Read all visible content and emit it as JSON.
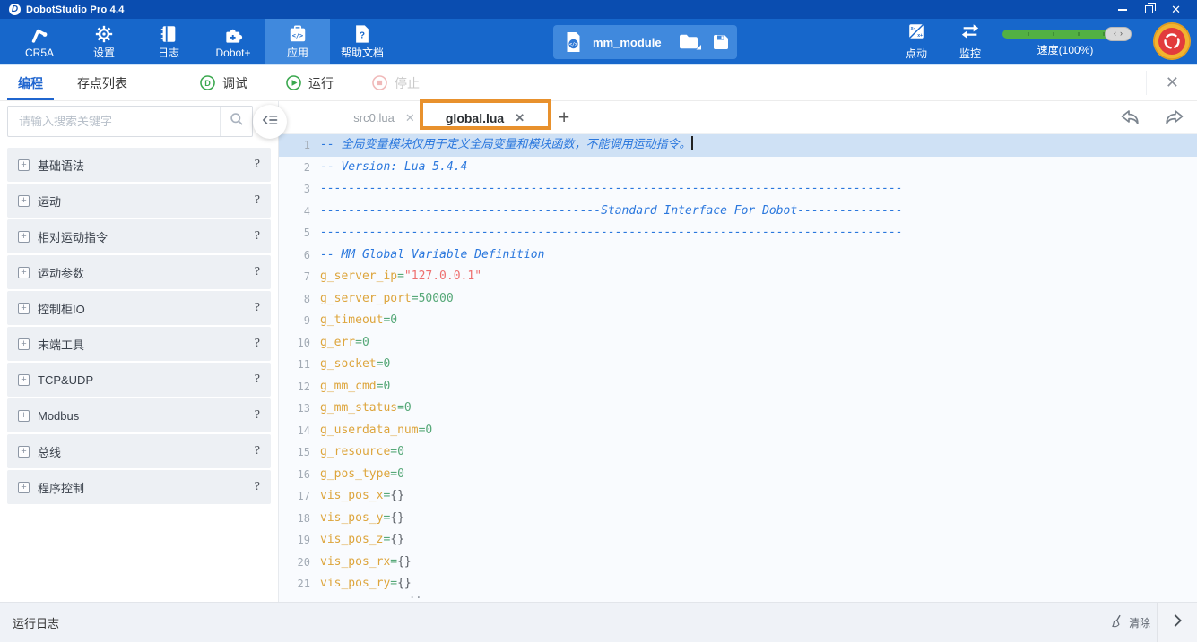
{
  "window": {
    "title": "DobotStudio Pro 4.4"
  },
  "toolbar": {
    "items": [
      {
        "key": "cr5a",
        "label": "CR5A",
        "icon": "robot-arm-icon",
        "active": false
      },
      {
        "key": "settings",
        "label": "设置",
        "icon": "gear-icon",
        "active": false
      },
      {
        "key": "logs",
        "label": "日志",
        "icon": "logbook-icon",
        "active": false
      },
      {
        "key": "dobot-plus",
        "label": "Dobot+",
        "icon": "puzzle-icon",
        "active": false
      },
      {
        "key": "apps",
        "label": "应用",
        "icon": "app-code-icon",
        "active": true
      },
      {
        "key": "help-docs",
        "label": "帮助文档",
        "icon": "help-doc-icon",
        "active": false
      }
    ],
    "project": {
      "name": "mm_module"
    },
    "right": {
      "jog_label": "点动",
      "monitor_label": "监控",
      "speed_label": "速度(100%)",
      "speed_percent": 100
    }
  },
  "nav": {
    "tabs": [
      {
        "key": "programming",
        "label": "编程",
        "active": true
      },
      {
        "key": "point-list",
        "label": "存点列表",
        "active": false
      }
    ],
    "actions": [
      {
        "key": "debug",
        "label": "调试",
        "disabled": false
      },
      {
        "key": "run",
        "label": "运行",
        "disabled": false
      },
      {
        "key": "stop",
        "label": "停止",
        "disabled": true
      }
    ]
  },
  "sidebar": {
    "search_placeholder": "请输入搜索关键字",
    "items": [
      {
        "label": "基础语法",
        "help": "?"
      },
      {
        "label": "运动",
        "help": "?"
      },
      {
        "label": "相对运动指令",
        "help": "?"
      },
      {
        "label": "运动参数",
        "help": "?"
      },
      {
        "label": "控制柜IO",
        "help": "?"
      },
      {
        "label": "末端工具",
        "help": "?"
      },
      {
        "label": "TCP&UDP",
        "help": "?"
      },
      {
        "label": "Modbus",
        "help": "?"
      },
      {
        "label": "总线",
        "help": "?"
      },
      {
        "label": "程序控制",
        "help": "?"
      }
    ]
  },
  "editor": {
    "tabs": [
      {
        "name": "src0.lua",
        "active": false,
        "annotated": false
      },
      {
        "name": "global.lua",
        "active": true,
        "annotated": true
      }
    ],
    "new_tab_label": "+",
    "overflow_hint": "..",
    "lines": [
      {
        "n": 1,
        "sel": true,
        "caret": true,
        "tk": [
          [
            "c",
            "-- 全局变量模块仅用于定义全局变量和模块函数，不能调用运动指令。"
          ]
        ]
      },
      {
        "n": 2,
        "tk": [
          [
            "c",
            "-- Version: Lua 5.4.4"
          ]
        ]
      },
      {
        "n": 3,
        "tk": [
          [
            "c",
            "-----------------------------------------------------------------------------------"
          ]
        ]
      },
      {
        "n": 4,
        "tk": [
          [
            "c",
            "----------------------------------------Standard Interface For Dobot---------------"
          ]
        ]
      },
      {
        "n": 5,
        "tk": [
          [
            "c",
            "-----------------------------------------------------------------------------------"
          ]
        ]
      },
      {
        "n": 6,
        "tk": [
          [
            "c",
            "-- MM Global Variable Definition"
          ]
        ]
      },
      {
        "n": 7,
        "tk": [
          [
            "v",
            "g_server_ip"
          ],
          [
            "o",
            "="
          ],
          [
            "s",
            "\"127.0.0.1\""
          ]
        ]
      },
      {
        "n": 8,
        "tk": [
          [
            "v",
            "g_server_port"
          ],
          [
            "o",
            "="
          ],
          [
            "n",
            "50000"
          ]
        ]
      },
      {
        "n": 9,
        "tk": [
          [
            "v",
            "g_timeout"
          ],
          [
            "o",
            "="
          ],
          [
            "n",
            "0"
          ]
        ]
      },
      {
        "n": 10,
        "tk": [
          [
            "v",
            "g_err"
          ],
          [
            "o",
            "="
          ],
          [
            "n",
            "0"
          ]
        ]
      },
      {
        "n": 11,
        "tk": [
          [
            "v",
            "g_socket"
          ],
          [
            "o",
            "="
          ],
          [
            "n",
            "0"
          ]
        ]
      },
      {
        "n": 12,
        "tk": [
          [
            "v",
            "g_mm_cmd"
          ],
          [
            "o",
            "="
          ],
          [
            "n",
            "0"
          ]
        ]
      },
      {
        "n": 13,
        "tk": [
          [
            "v",
            "g_mm_status"
          ],
          [
            "o",
            "="
          ],
          [
            "n",
            "0"
          ]
        ]
      },
      {
        "n": 14,
        "tk": [
          [
            "v",
            "g_userdata_num"
          ],
          [
            "o",
            "="
          ],
          [
            "n",
            "0"
          ]
        ]
      },
      {
        "n": 15,
        "tk": [
          [
            "v",
            "g_resource"
          ],
          [
            "o",
            "="
          ],
          [
            "n",
            "0"
          ]
        ]
      },
      {
        "n": 16,
        "tk": [
          [
            "v",
            "g_pos_type"
          ],
          [
            "o",
            "="
          ],
          [
            "n",
            "0"
          ]
        ]
      },
      {
        "n": 17,
        "tk": [
          [
            "v",
            "vis_pos_x"
          ],
          [
            "o",
            "="
          ],
          [
            "b",
            "{}"
          ]
        ]
      },
      {
        "n": 18,
        "tk": [
          [
            "v",
            "vis_pos_y"
          ],
          [
            "o",
            "="
          ],
          [
            "b",
            "{}"
          ]
        ]
      },
      {
        "n": 19,
        "tk": [
          [
            "v",
            "vis_pos_z"
          ],
          [
            "o",
            "="
          ],
          [
            "b",
            "{}"
          ]
        ]
      },
      {
        "n": 20,
        "tk": [
          [
            "v",
            "vis_pos_rx"
          ],
          [
            "o",
            "="
          ],
          [
            "b",
            "{}"
          ]
        ]
      },
      {
        "n": 21,
        "tk": [
          [
            "v",
            "vis_pos_ry"
          ],
          [
            "o",
            "="
          ],
          [
            "b",
            "{}"
          ]
        ]
      }
    ]
  },
  "log_bar": {
    "title": "运行日志",
    "clear_label": "清除"
  },
  "colors": {
    "titlebar_bg": "#0a4db0",
    "toolbar_bg": "#1767cb",
    "active_item_bg": "#4089dd",
    "accent_blue": "#1f65cf",
    "annotation_orange": "#e8912d",
    "selection_blue": "#cfe1f5",
    "comment": "#2a77dd",
    "variable": "#dda53c",
    "number_operator": "#56a878",
    "string": "#ee6f6f",
    "run_green": "#3aa84e",
    "stop_pink": "#f0b9b9",
    "slider_green": "#52b043",
    "estop_red": "#e23c3c",
    "estop_yellow": "#f2b430"
  }
}
